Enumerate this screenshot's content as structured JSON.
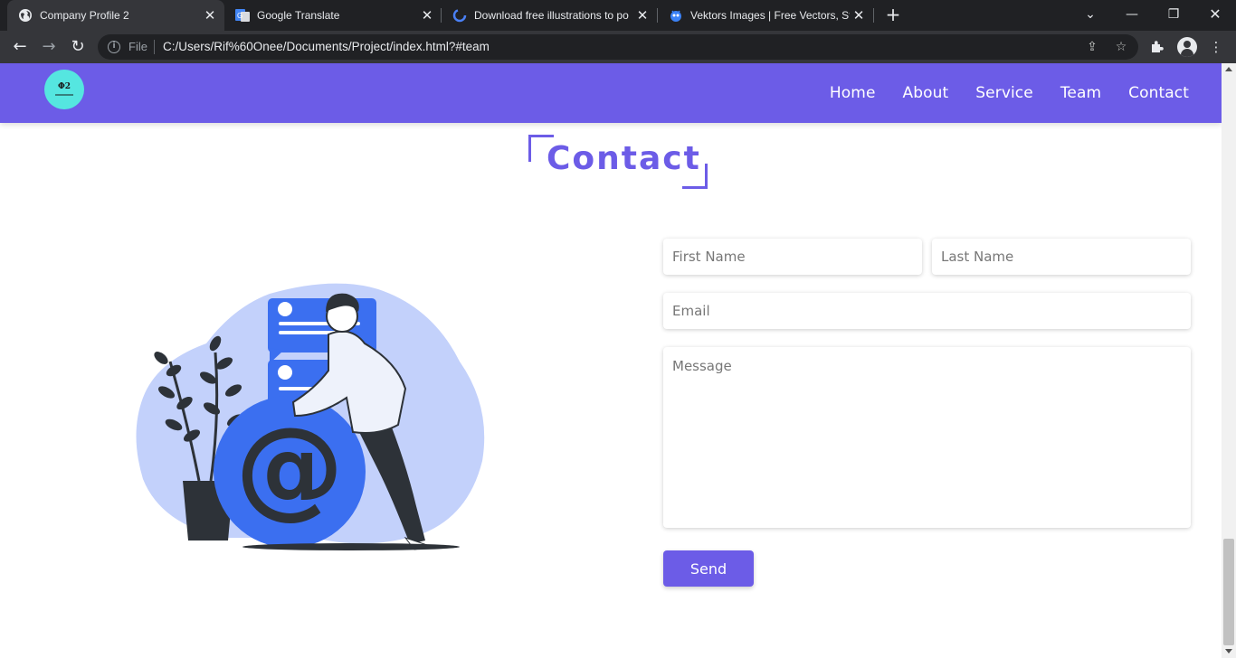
{
  "browser": {
    "tabs": [
      {
        "title": "Company Profile 2",
        "active": true
      },
      {
        "title": "Google Translate",
        "active": false
      },
      {
        "title": "Download free illustrations to po",
        "active": false
      },
      {
        "title": "Vektors Images | Free Vectors, Sto",
        "active": false
      }
    ],
    "new_tab_symbol": "+",
    "omnibox": {
      "scheme_label": "File",
      "url": "C:/Users/Rif%60Onee/Documents/Project/index.html?#team"
    }
  },
  "site": {
    "logo_text": "Φ2",
    "nav": [
      "Home",
      "About",
      "Service",
      "Team",
      "Contact"
    ],
    "section_title": "Contact",
    "form": {
      "first_name_placeholder": "First Name",
      "last_name_placeholder": "Last Name",
      "email_placeholder": "Email",
      "message_placeholder": "Message",
      "send_label": "Send"
    },
    "colors": {
      "brand": "#6c5ce7",
      "logo_bg": "#55e6e0",
      "illustration_blob": "#c3d1fb",
      "illustration_circle": "#3b6ff0"
    }
  }
}
